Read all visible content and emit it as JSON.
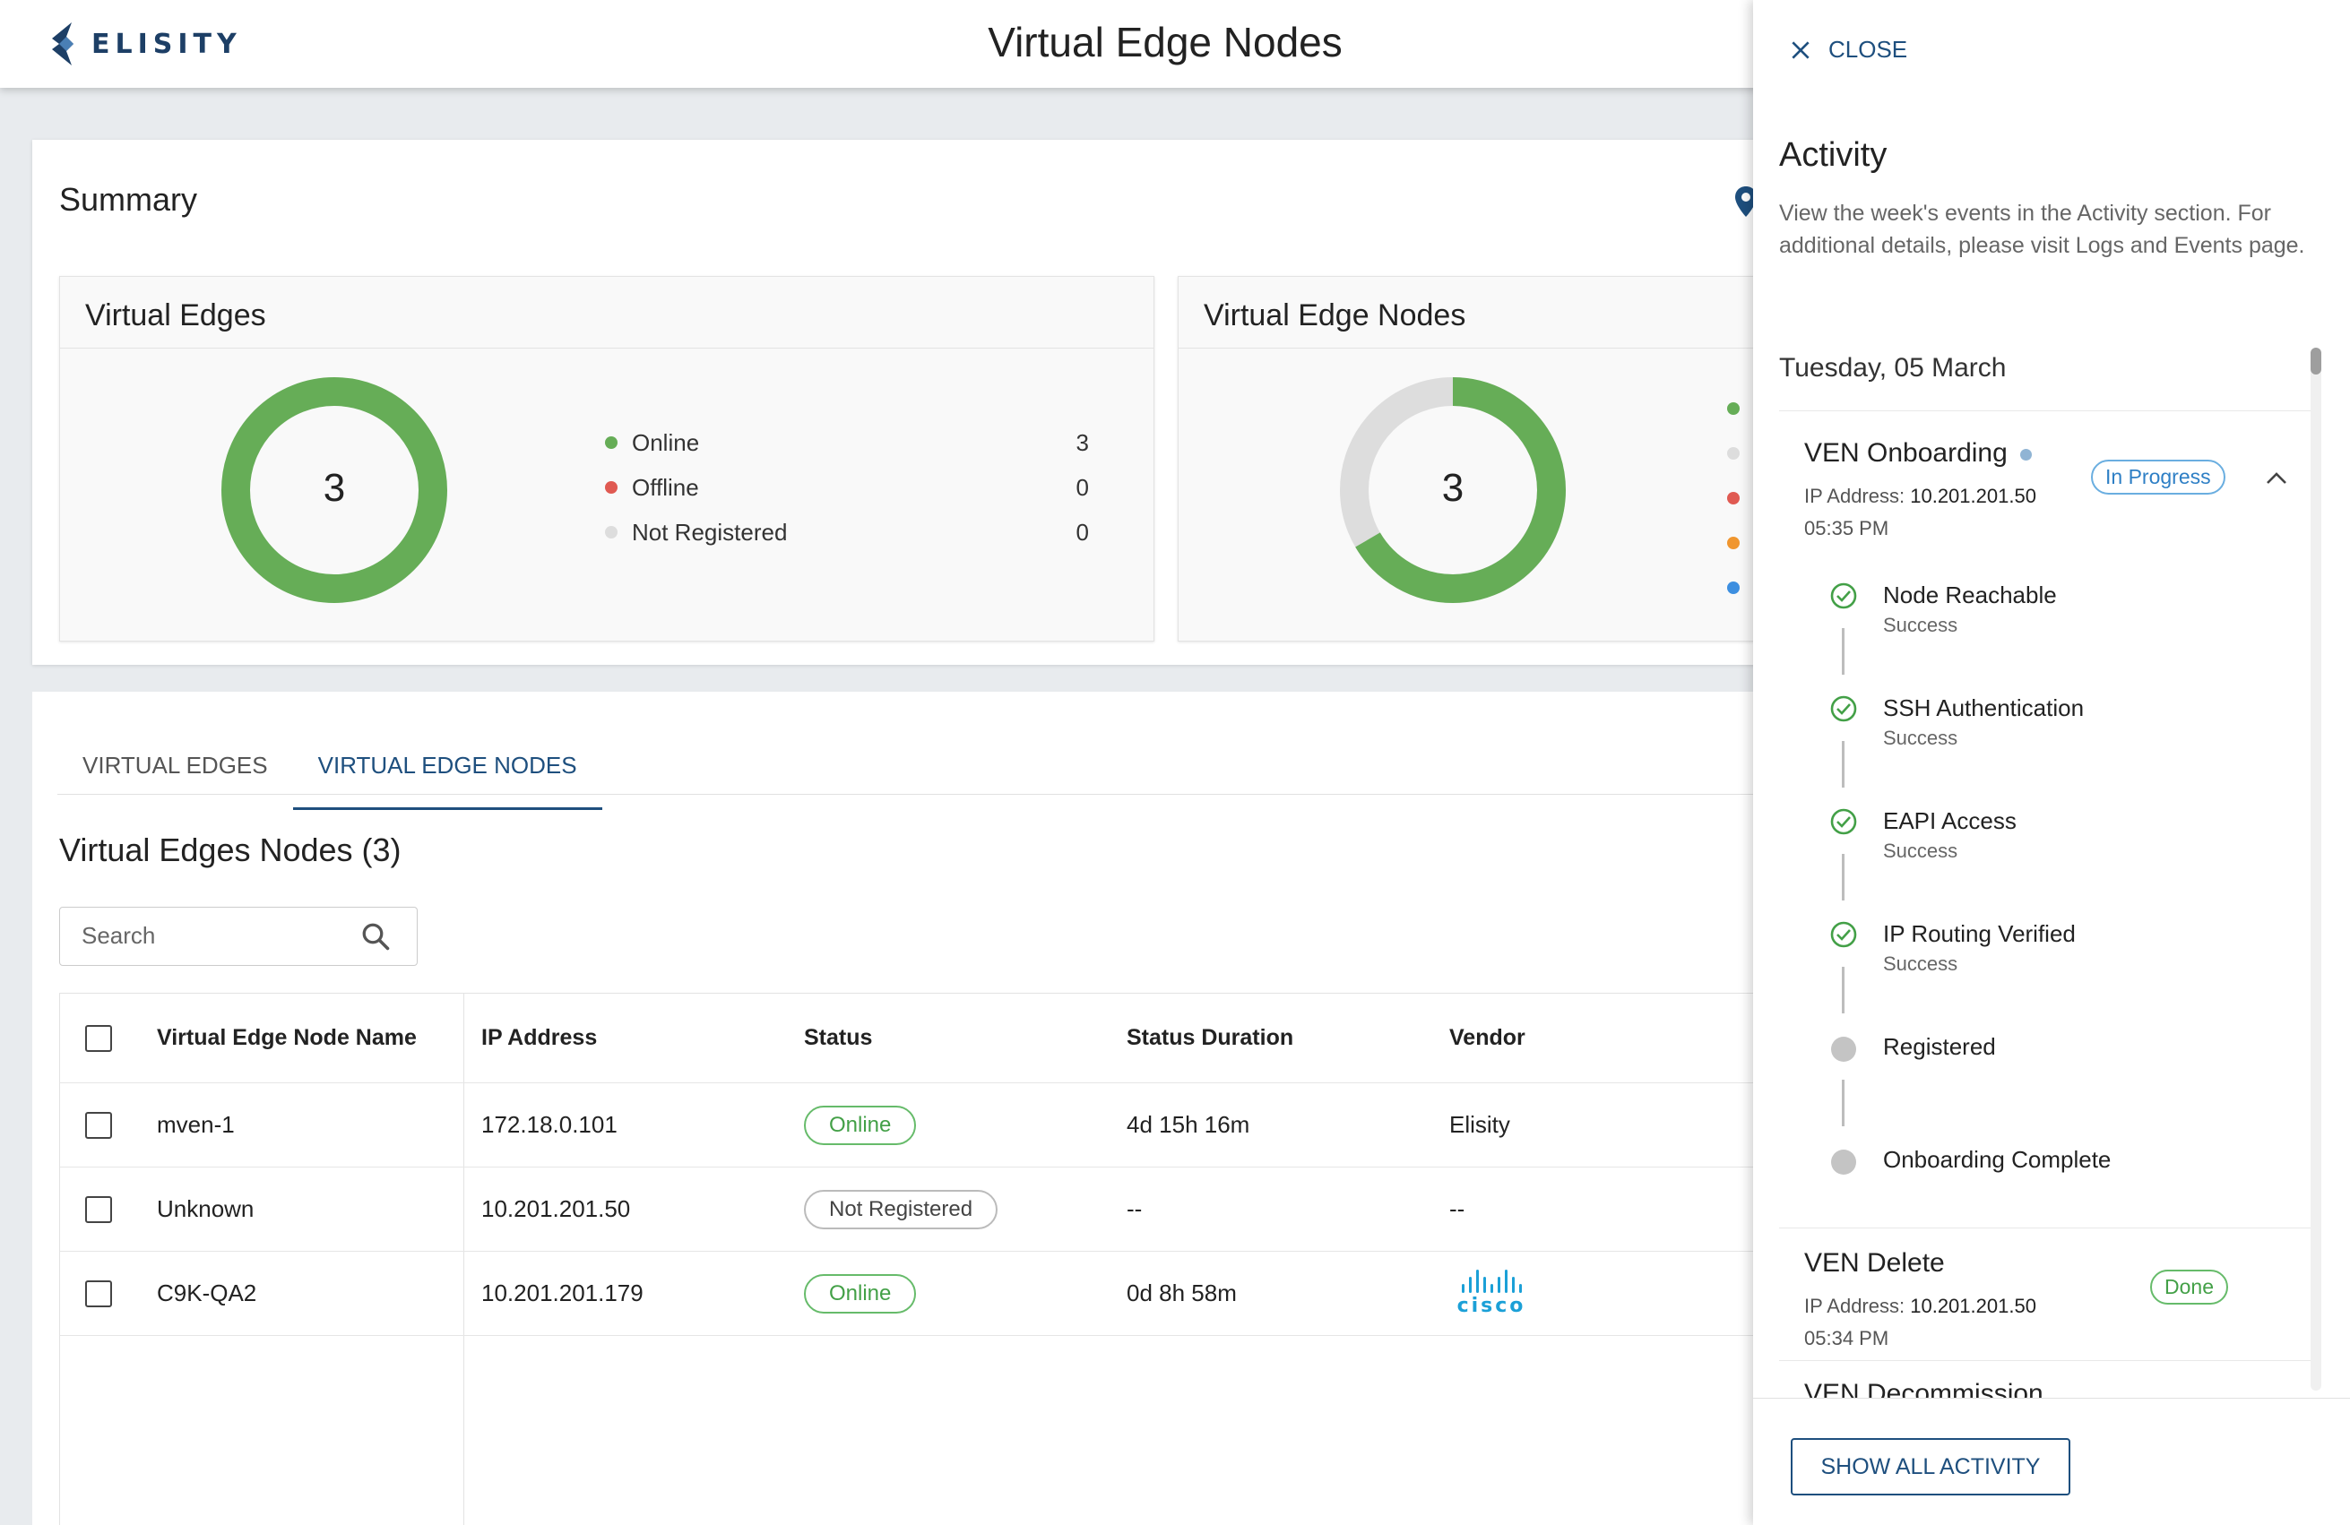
{
  "app": {
    "brand": "ELISITY",
    "title": "Virtual Edge Nodes"
  },
  "summary": {
    "title": "Summary",
    "virtual_edges": {
      "title": "Virtual Edges",
      "total": "3",
      "legend": [
        {
          "label": "Online",
          "count": "3",
          "color": "#66ad57"
        },
        {
          "label": "Offline",
          "count": "0",
          "color": "#e05a52"
        },
        {
          "label": "Not Registered",
          "count": "0",
          "color": "#dddddd"
        }
      ]
    },
    "virtual_edge_nodes": {
      "title": "Virtual Edge Nodes",
      "total": "3",
      "legend_colors": [
        "#66ad57",
        "#dddddd",
        "#e05a52",
        "#f0962f",
        "#3d8fe0"
      ]
    }
  },
  "tabs": [
    {
      "label": "VIRTUAL EDGES",
      "active": false
    },
    {
      "label": "VIRTUAL EDGE NODES",
      "active": true
    }
  ],
  "list": {
    "title": "Virtual Edges Nodes (3)",
    "search_placeholder": "Search",
    "columns": [
      "Virtual Edge Node Name",
      "IP Address",
      "Status",
      "Status Duration",
      "Vendor"
    ],
    "rows": [
      {
        "name": "mven-1",
        "ip": "172.18.0.101",
        "status": "Online",
        "duration": "4d 15h 16m",
        "vendor": "Elisity"
      },
      {
        "name": "Unknown",
        "ip": "10.201.201.50",
        "status": "Not Registered",
        "duration": "--",
        "vendor": "--"
      },
      {
        "name": "C9K-QA2",
        "ip": "10.201.201.179",
        "status": "Online",
        "duration": "0d 8h 58m",
        "vendor": "cisco"
      }
    ]
  },
  "activity": {
    "close_label": "CLOSE",
    "title": "Activity",
    "description": "View the week's events in the Activity section. For additional details, please visit Logs and Events page.",
    "day": "Tuesday, 05 March",
    "events": [
      {
        "name": "VEN Onboarding",
        "ip_label": "IP Address:",
        "ip": "10.201.201.50",
        "time": "05:35 PM",
        "status": "In Progress",
        "steps": [
          {
            "name": "Node Reachable",
            "status": "Success",
            "state": "done"
          },
          {
            "name": "SSH Authentication",
            "status": "Success",
            "state": "done"
          },
          {
            "name": "EAPI Access",
            "status": "Success",
            "state": "done"
          },
          {
            "name": "IP Routing Verified",
            "status": "Success",
            "state": "done"
          },
          {
            "name": "Registered",
            "status": "",
            "state": "pending"
          },
          {
            "name": "Onboarding Complete",
            "status": "",
            "state": "pending"
          }
        ]
      },
      {
        "name": "VEN Delete",
        "ip_label": "IP Address:",
        "ip": "10.201.201.50",
        "time": "05:34 PM",
        "status": "Done"
      },
      {
        "name": "VEN Decommission"
      }
    ],
    "show_all_label": "SHOW ALL ACTIVITY"
  }
}
